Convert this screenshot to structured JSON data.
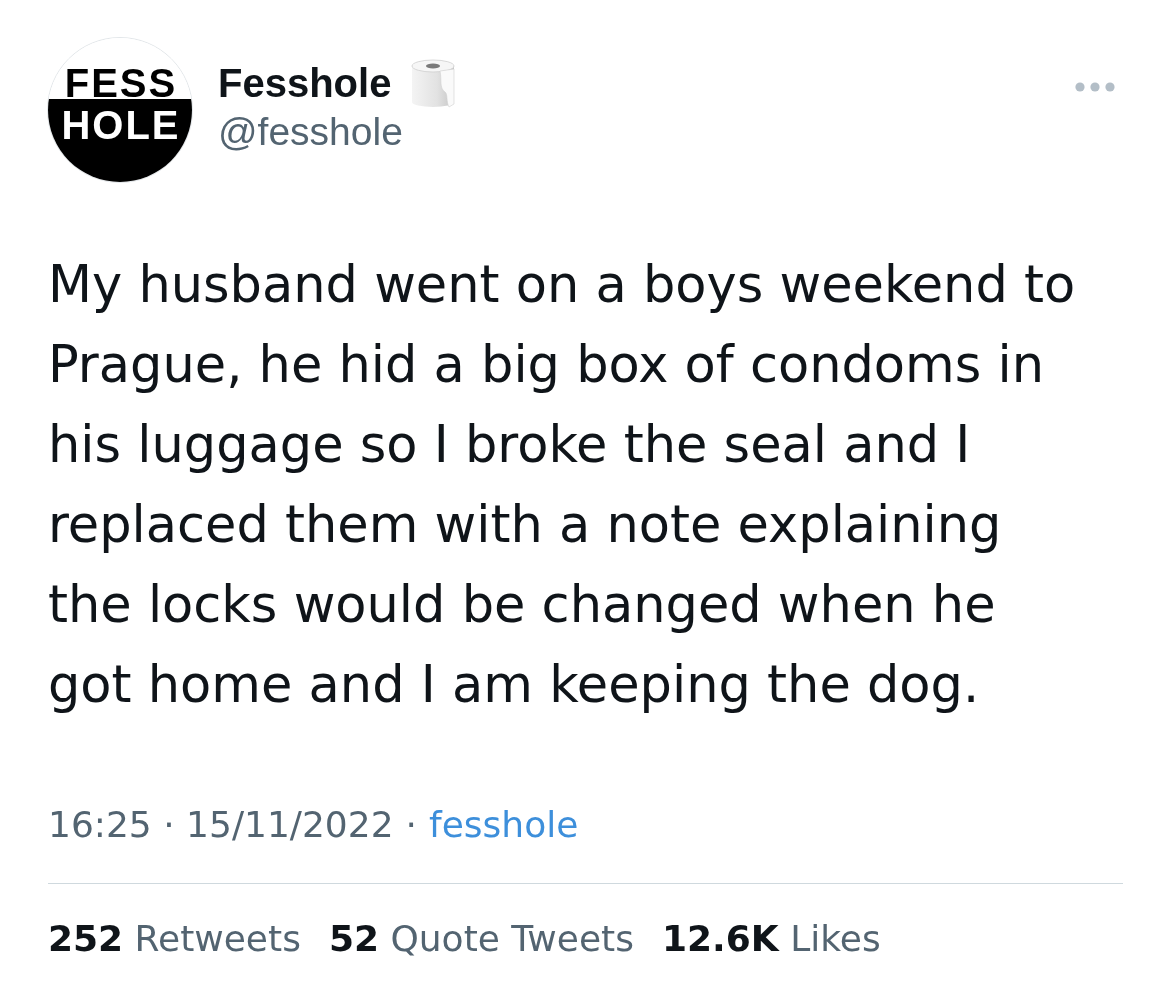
{
  "author": {
    "avatar_logo": [
      "FESS",
      "HOLE"
    ],
    "name": "Fesshole",
    "handle": "@fesshole"
  },
  "tweet": {
    "text": "My husband went on a boys weekend to Prague, he hid a big box of condoms in his luggage so I broke the seal and I replaced them with a note explaining the locks would be changed when he got home and I am keeping the dog."
  },
  "meta": {
    "timestamp": "16:25 · 15/11/2022",
    "separator": "·",
    "source": "fesshole"
  },
  "stats": [
    {
      "count": "252",
      "label": "Retweets"
    },
    {
      "count": "52",
      "label": "Quote Tweets"
    },
    {
      "count": "12.6K",
      "label": "Likes"
    }
  ]
}
